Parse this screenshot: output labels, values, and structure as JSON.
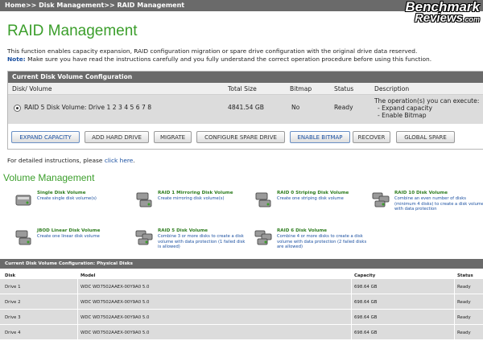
{
  "breadcrumb": "Home>> Disk Management>> RAID Management",
  "watermark": {
    "line1": "Benchmark",
    "line2": "Reviews",
    "suffix": ".com"
  },
  "page_title": "RAID Management",
  "intro": {
    "text": "This function enables capacity expansion, RAID configuration migration or spare drive configuration with the original drive data reserved.",
    "note_label": "Note:",
    "note_text": "Make sure you have read the instructions carefully and you fully understand the correct operation procedure before using this function."
  },
  "volume_config": {
    "title": "Current Disk Volume Configuration",
    "columns": [
      "Disk/ Volume",
      "Total Size",
      "Bitmap",
      "Status",
      "Description"
    ],
    "row": {
      "volume": "RAID 5 Disk Volume: Drive 1 2 3 4 5 6 7 8",
      "size": "4841.54 GB",
      "bitmap": "No",
      "status": "Ready",
      "ops_title": "The operation(s) you can execute:",
      "ops": [
        "- Expand capacity",
        "- Enable Bitmap"
      ]
    },
    "buttons": [
      "EXPAND CAPACITY",
      "ADD HARD DRIVE",
      "MIGRATE",
      "CONFIGURE SPARE DRIVE",
      "ENABLE BITMAP",
      "RECOVER",
      "GLOBAL SPARE"
    ]
  },
  "detail": {
    "prefix": "For detailed instructions, please",
    "link": "click here",
    "suffix": "."
  },
  "volume_management": {
    "title": "Volume Management",
    "items": [
      {
        "title": "Single Disk Volume",
        "desc": "Create single disk volume(s)",
        "icon": "single-disk-icon"
      },
      {
        "title": "RAID 1 Mirroring Disk Volume",
        "desc": "Create mirroring disk volume(s)",
        "icon": "raid1-icon"
      },
      {
        "title": "RAID 0 Striping Disk Volume",
        "desc": "Create one striping disk volume",
        "icon": "raid0-icon"
      },
      {
        "title": "RAID 10 Disk Volume",
        "desc": "Combine an even number of disks (minimum 4 disks) to create a disk volume with data protection",
        "icon": "raid10-icon"
      },
      {
        "title": "JBOD Linear Disk Volume",
        "desc": "Create one linear disk volume",
        "icon": "jbod-icon"
      },
      {
        "title": "RAID 5 Disk Volume",
        "desc": "Combine 3 or more disks to create a disk volume with data protection (1 failed disk is allowed)",
        "icon": "raid5-icon"
      },
      {
        "title": "RAID 6 Disk Volume",
        "desc": "Combine 4 or more disks to create a disk volume with data protection (2 failed disks are allowed)",
        "icon": "raid6-icon"
      }
    ]
  },
  "physical_disks": {
    "title": "Current Disk Volume Configuration: Physical Disks",
    "columns": [
      "Disk",
      "Model",
      "Capacity",
      "Status"
    ],
    "rows": [
      {
        "disk": "Drive 1",
        "model": "WDC WD7502AAEX-00Y9A0 5.0",
        "capacity": "698.64 GB",
        "status": "Ready"
      },
      {
        "disk": "Drive 2",
        "model": "WDC WD7502AAEX-00Y9A0 5.0",
        "capacity": "698.64 GB",
        "status": "Ready"
      },
      {
        "disk": "Drive 3",
        "model": "WDC WD7502AAEX-00Y9A0 5.0",
        "capacity": "698.64 GB",
        "status": "Ready"
      },
      {
        "disk": "Drive 4",
        "model": "WDC WD7502AAEX-00Y9A0 5.0",
        "capacity": "698.64 GB",
        "status": "Ready"
      }
    ]
  },
  "colors": {
    "accent_green": "#3b9e2b",
    "link_blue": "#1a4fa0",
    "header_gray": "#6a6a6a"
  }
}
